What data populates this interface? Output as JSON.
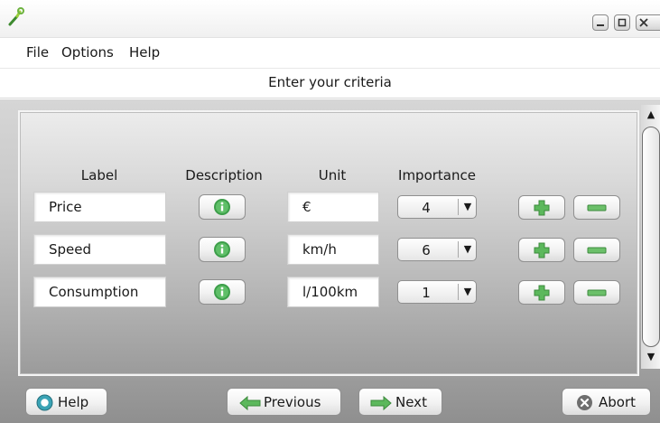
{
  "menu": [
    "File",
    "Options",
    "Help"
  ],
  "header": {
    "title": "Enter your criteria"
  },
  "columns": {
    "label": "Label",
    "description": "Description",
    "unit": "Unit",
    "importance": "Importance"
  },
  "rows": [
    {
      "label": "Price",
      "unit": "€",
      "importance": "4"
    },
    {
      "label": "Speed",
      "unit": "km/h",
      "importance": "6"
    },
    {
      "label": "Consumption",
      "unit": "l/100km",
      "importance": "1"
    }
  ],
  "buttons": {
    "help": "Help",
    "previous": "Previous",
    "next": "Next",
    "abort": "Abort"
  },
  "icons": {
    "app": "wrench-icon",
    "info": "info-icon",
    "add": "plus-icon",
    "remove": "minus-icon",
    "help": "lifebuoy-icon",
    "previous": "arrow-left-icon",
    "next": "arrow-right-icon",
    "abort": "close-circle-icon"
  },
  "colors": {
    "info_green": "#3d9e4a",
    "plus_green": "#5cb85c",
    "minus_green": "#6cc06a",
    "abort_gray": "#6e6e6e",
    "help_teal": "#2f8fa0"
  }
}
